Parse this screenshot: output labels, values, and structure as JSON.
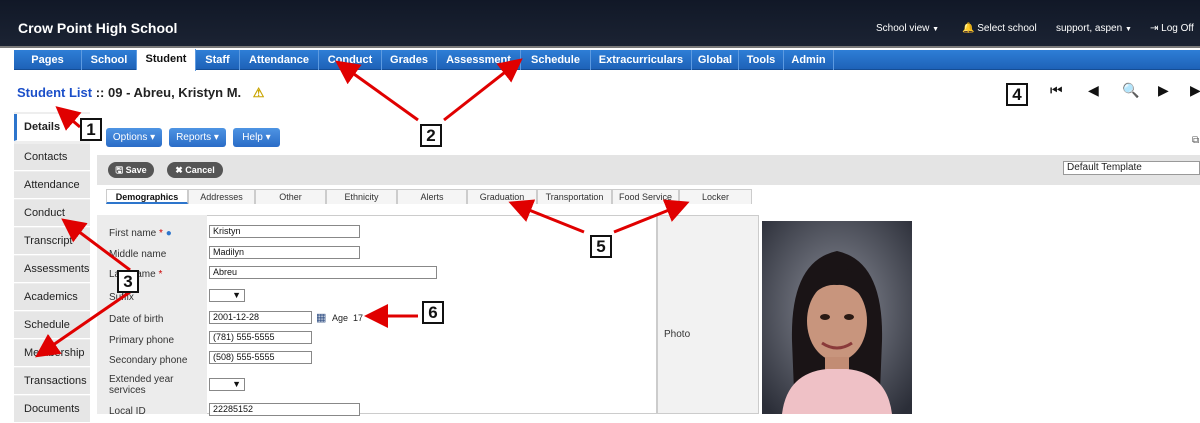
{
  "app": {
    "school_name": "Crow Point High School",
    "school_view": "School view",
    "select_school": "Select school",
    "user": "support, aspen",
    "log_off": "Log Off"
  },
  "nav_tabs": [
    "Pages",
    "School",
    "Student",
    "Staff",
    "Attendance",
    "Conduct",
    "Grades",
    "Assessment",
    "Schedule",
    "Extracurriculars",
    "Global",
    "Tools",
    "Admin"
  ],
  "active_nav": "Student",
  "breadcrumb": {
    "link": "Student List",
    "rest": " :: 09 - Abreu, Kristyn M."
  },
  "side_tabs": [
    "Details",
    "Contacts",
    "Attendance",
    "Conduct",
    "Transcript",
    "Assessments",
    "Academics",
    "Schedule",
    "Membership",
    "Transactions",
    "Documents"
  ],
  "buttons": {
    "options": "Options",
    "reports": "Reports",
    "help": "Help",
    "save": "Save",
    "cancel": "Cancel"
  },
  "template": "Default Template",
  "sub_tabs": [
    "Demographics",
    "Addresses",
    "Other",
    "Ethnicity",
    "Alerts",
    "Graduation",
    "Transportation",
    "Food Service",
    "Locker"
  ],
  "form": {
    "first_name_label": "First name",
    "first_name": "Kristyn",
    "middle_name_label": "Middle name",
    "middle_name": "Madilyn",
    "last_name_label": "Last name",
    "last_name": "Abreu",
    "suffix_label": "Suffix",
    "dob_label": "Date of birth",
    "dob": "2001-12-28",
    "age_label": "Age",
    "age": "17",
    "primary_phone_label": "Primary phone",
    "primary_phone": "(781) 555-5555",
    "secondary_phone_label": "Secondary phone",
    "secondary_phone": "(508) 555-5555",
    "extended_label": "Extended year services",
    "local_id_label": "Local ID",
    "local_id": "22285152",
    "photo_label": "Photo"
  },
  "annotations": [
    "1",
    "2",
    "3",
    "4",
    "5",
    "6"
  ],
  "colors": {
    "nav_blue": "#2e7ed6",
    "top_dark": "#111827",
    "annotation_red": "#e00000",
    "link_blue": "#1b4fc9"
  }
}
